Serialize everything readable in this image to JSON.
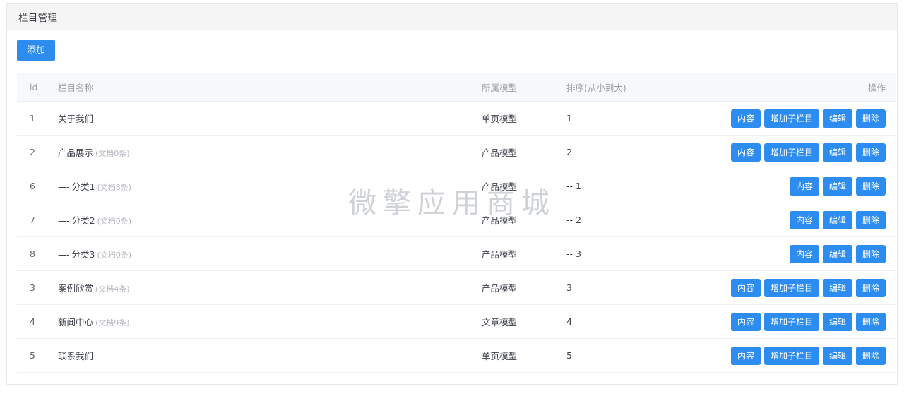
{
  "page": {
    "title": "栏目管理",
    "watermark": "微擎应用商城"
  },
  "toolbar": {
    "add_label": "添加"
  },
  "table": {
    "headers": {
      "id": "id",
      "name": "栏目名称",
      "model": "所属模型",
      "sort": "排序(从小到大)",
      "ops": "操作"
    },
    "rows": [
      {
        "id": "1",
        "prefix": "",
        "name": "关于我们",
        "doc_count": "",
        "model": "单页模型",
        "sort": "1",
        "ops": [
          "内容",
          "增加子栏目",
          "编辑",
          "删除"
        ]
      },
      {
        "id": "2",
        "prefix": "",
        "name": "产品展示",
        "doc_count": "(文档0条)",
        "model": "产品模型",
        "sort": "2",
        "ops": [
          "内容",
          "增加子栏目",
          "编辑",
          "删除"
        ]
      },
      {
        "id": "6",
        "prefix": "---- ",
        "name": "分类1",
        "doc_count": "(文档8条)",
        "model": "产品模型",
        "sort": "-- 1",
        "ops": [
          "内容",
          "编辑",
          "删除"
        ]
      },
      {
        "id": "7",
        "prefix": "---- ",
        "name": "分类2",
        "doc_count": "(文档0条)",
        "model": "产品模型",
        "sort": "-- 2",
        "ops": [
          "内容",
          "编辑",
          "删除"
        ]
      },
      {
        "id": "8",
        "prefix": "---- ",
        "name": "分类3",
        "doc_count": "(文档0条)",
        "model": "产品模型",
        "sort": "-- 3",
        "ops": [
          "内容",
          "编辑",
          "删除"
        ]
      },
      {
        "id": "3",
        "prefix": "",
        "name": "案例欣赏",
        "doc_count": "(文档4条)",
        "model": "产品模型",
        "sort": "3",
        "ops": [
          "内容",
          "增加子栏目",
          "编辑",
          "删除"
        ]
      },
      {
        "id": "4",
        "prefix": "",
        "name": "新闻中心",
        "doc_count": "(文档9条)",
        "model": "文章模型",
        "sort": "4",
        "ops": [
          "内容",
          "增加子栏目",
          "编辑",
          "删除"
        ]
      },
      {
        "id": "5",
        "prefix": "",
        "name": "联系我们",
        "doc_count": "",
        "model": "单页模型",
        "sort": "5",
        "ops": [
          "内容",
          "增加子栏目",
          "编辑",
          "删除"
        ]
      }
    ]
  },
  "colors": {
    "primary": "#2d8cf0",
    "heading_bg": "#f5f5f5",
    "table_head_bg": "#f7f8fa",
    "border": "#e4e7ed",
    "watermark": "#cfd2d6"
  }
}
